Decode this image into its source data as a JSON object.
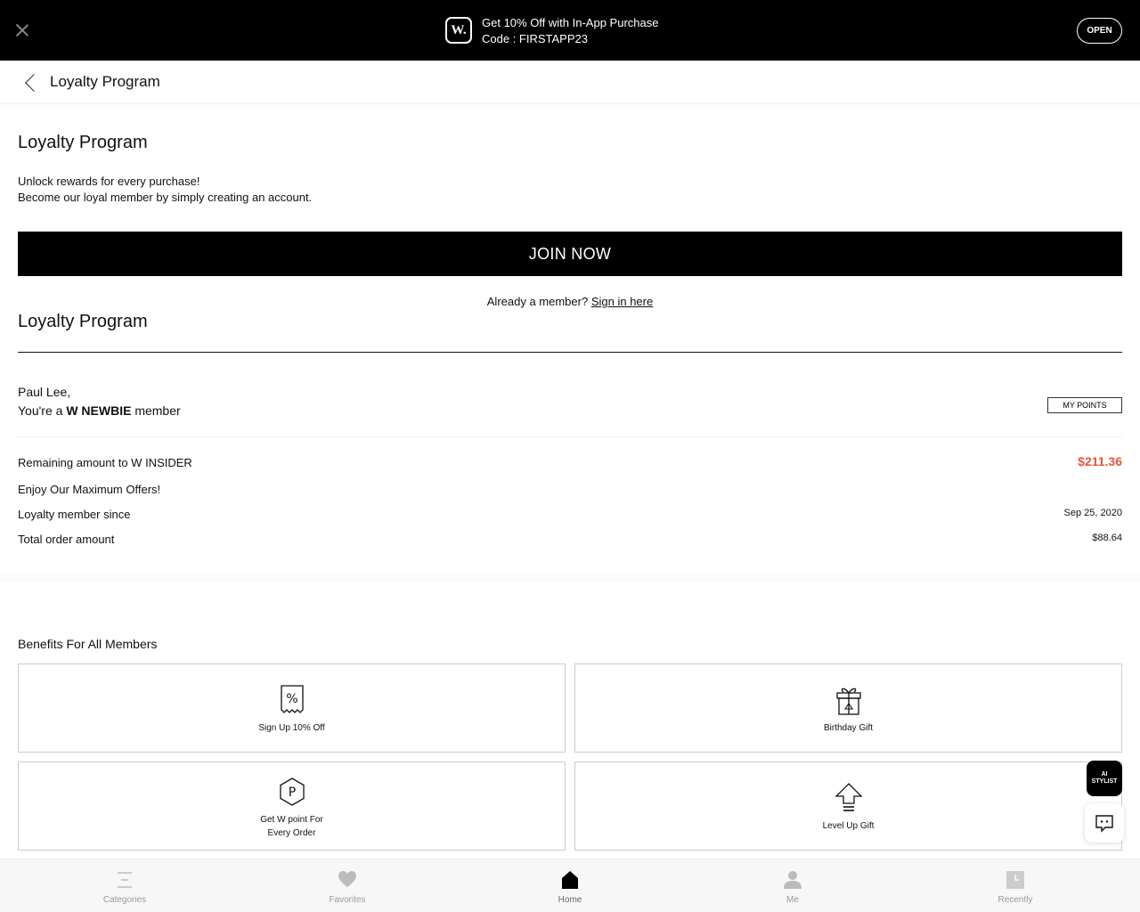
{
  "promo": {
    "logo_text": "W.",
    "line1": "Get 10% Off with In-App Purchase",
    "line2": "Code : FIRSTAPP23",
    "open_label": "OPEN"
  },
  "header": {
    "title": "Loyalty Program"
  },
  "join_section": {
    "title": "Loyalty Program",
    "line1": "Unlock rewards for every purchase!",
    "line2": "Become our loyal member by simply creating an account.",
    "join_label": "JOIN NOW",
    "already_text": "Already a member?",
    "signin_link": "Sign in here"
  },
  "member_section": {
    "title": "Loyalty Program",
    "name": "Paul Lee,",
    "status_prefix": "You're a",
    "status_tier": "W NEWBIE",
    "status_suffix": "member",
    "my_points_label": "MY POINTS",
    "rows": [
      {
        "label": "Remaining amount to W INSIDER",
        "value": "$211.36"
      },
      {
        "label": "Enjoy Our Maximum Offers!",
        "value": ""
      },
      {
        "label": "Loyalty member since",
        "value": "Sep 25, 2020"
      },
      {
        "label": "Total order amount",
        "value": "$88.64"
      }
    ]
  },
  "benefits": {
    "title": "Benefits For All Members",
    "items": [
      {
        "label": "Sign Up 10% Off",
        "icon": "percent-coupon-icon"
      },
      {
        "label": "Birthday Gift",
        "icon": "gift-icon"
      },
      {
        "label_line1": "Get W point For",
        "label_line2": "Every Order",
        "icon": "p-hexagon-icon"
      },
      {
        "label": "Level Up Gift",
        "icon": "level-up-arrow-icon"
      }
    ]
  },
  "floating": {
    "ai_line1": "AI",
    "ai_line2": "STYLIST"
  },
  "bottom_nav": [
    {
      "label": "Categories",
      "icon": "menu-icon"
    },
    {
      "label": "Favorites",
      "icon": "heart-icon"
    },
    {
      "label": "Home",
      "icon": "home-icon",
      "active": true
    },
    {
      "label": "Me",
      "icon": "person-icon"
    },
    {
      "label": "Recently",
      "icon": "clock-icon"
    }
  ],
  "colors": {
    "price": "#e4563e",
    "banner": "#000000",
    "join_button": "#000000"
  }
}
